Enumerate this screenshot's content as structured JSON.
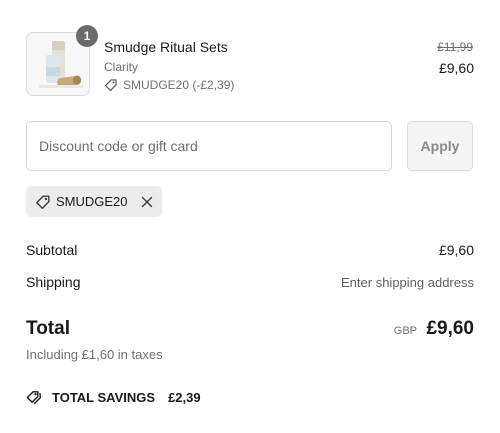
{
  "product": {
    "quantity": "1",
    "name": "Smudge Ritual Sets",
    "variant": "Clarity",
    "discount": "SMUDGE20 (-£2,39)",
    "price_original": "£11,99",
    "price_final": "£9,60",
    "image_icon": "product-photo-icon"
  },
  "discount_form": {
    "placeholder": "Discount code or gift card",
    "apply_label": "Apply"
  },
  "applied_code": {
    "code": "SMUDGE20",
    "icon": "tag-icon",
    "remove_icon": "close-icon"
  },
  "summary": {
    "subtotal_label": "Subtotal",
    "subtotal_value": "£9,60",
    "shipping_label": "Shipping",
    "shipping_value": "Enter shipping address",
    "total_label": "Total",
    "total_currency": "GBP",
    "total_value": "£9,60",
    "taxes_note": "Including £1,60 in taxes",
    "savings_label": "TOTAL SAVINGS",
    "savings_value": "£2,39",
    "savings_icon": "tags-icon"
  },
  "colors": {
    "text": "#1a1a1a",
    "muted": "#707070",
    "badge": "#6b6b6b",
    "chip_bg": "#ececec",
    "button_bg": "#f4f4f4"
  }
}
